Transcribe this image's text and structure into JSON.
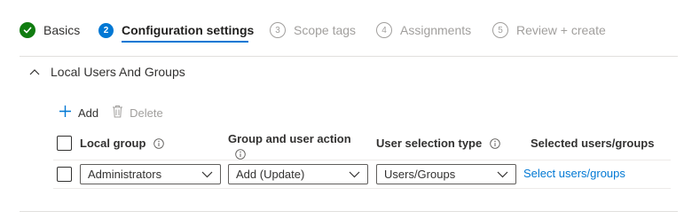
{
  "steps": [
    {
      "label": "Basics",
      "state": "done"
    },
    {
      "number": "2",
      "label": "Configuration settings",
      "state": "active"
    },
    {
      "number": "3",
      "label": "Scope tags",
      "state": "pending"
    },
    {
      "number": "4",
      "label": "Assignments",
      "state": "pending"
    },
    {
      "number": "5",
      "label": "Review + create",
      "state": "pending"
    }
  ],
  "section": {
    "title": "Local Users And Groups",
    "expanded": true
  },
  "toolbar": {
    "add_label": "Add",
    "delete_label": "Delete"
  },
  "table": {
    "columns": {
      "local_group": "Local group",
      "group_user_action": "Group and user action",
      "user_selection_type": "User selection type",
      "selected_users_groups": "Selected users/groups"
    },
    "rows": [
      {
        "local_group": "Administrators",
        "action": "Add (Update)",
        "selection_type": "Users/Groups",
        "select_link": "Select users/groups"
      }
    ]
  },
  "colors": {
    "accent": "#0078d4",
    "success": "#107c10",
    "disabled": "#a19f9d",
    "text": "#323130"
  },
  "icons": {
    "check": "checkmark-icon",
    "chevron_up": "chevron-up-icon",
    "add": "plus-icon",
    "delete": "trash-icon",
    "info": "info-icon",
    "dropdown": "chevron-down-icon"
  }
}
